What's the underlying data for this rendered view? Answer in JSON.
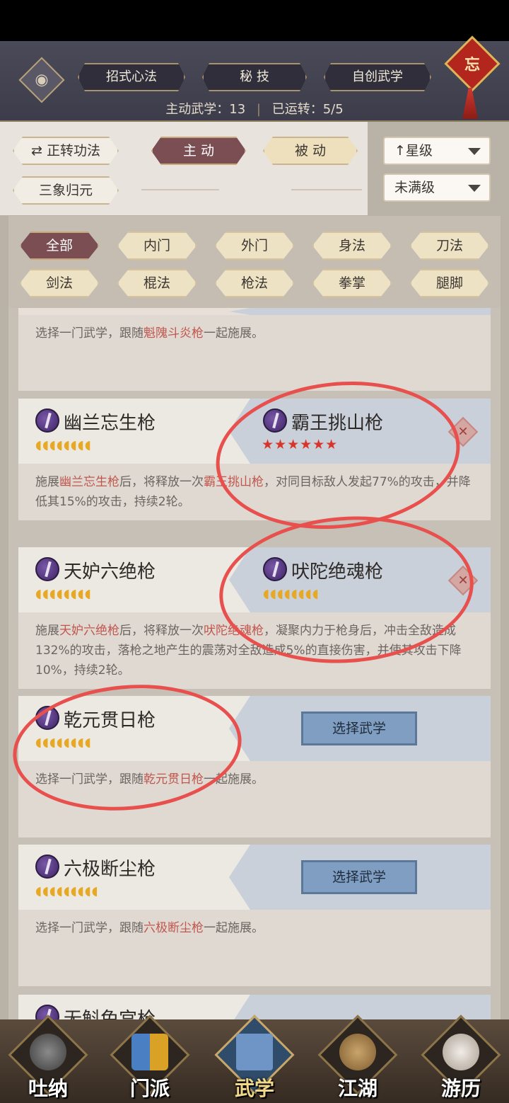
{
  "header": {
    "tabs": [
      {
        "label": "招式心法"
      },
      {
        "label": "秘 技"
      },
      {
        "label": "自创武学"
      }
    ],
    "badge": "忘",
    "stats": {
      "active_label": "主动武学：13",
      "running_label": "已运转：5/5"
    }
  },
  "filters": {
    "mode_btn": "正转功法",
    "active_btn": "主 动",
    "passive_btn": "被 动",
    "sanxiang_btn": "三象归元",
    "sort_dropdown": "星级",
    "level_dropdown": "未满级"
  },
  "categories": [
    "全部",
    "内门",
    "外门",
    "身法",
    "刀法",
    "剑法",
    "棍法",
    "枪法",
    "拳掌",
    "腿脚"
  ],
  "cards": {
    "card0": {
      "desc_pre": "选择一门武学，跟随",
      "desc_hl": "魁隗斗炎枪",
      "desc_post": "一起施展。"
    },
    "card1": {
      "left_name": "幽兰忘生枪",
      "left_moons": "◖◖◖◖◖◖◖◖",
      "right_name": "霸王挑山枪",
      "right_stars": "★★★★★★",
      "desc_a": "施展",
      "desc_hl1": "幽兰忘生枪",
      "desc_b": "后，将释放一次",
      "desc_hl2": "霸王挑山枪",
      "desc_c": "，对同目标敌人发起77%的攻击，并降低其15%的攻击，持续2轮。"
    },
    "card2": {
      "left_name": "天妒六绝枪",
      "left_moons": "◖◖◖◖◖◖◖◖",
      "right_name": "吠陀绝魂枪",
      "right_moons": "◖◖◖◖◖◖◖◖",
      "desc_a": "施展",
      "desc_hl1": "天妒六绝枪",
      "desc_b": "后，将释放一次",
      "desc_hl2": "吠陀绝魂枪",
      "desc_c": "，凝聚内力于枪身后，冲击全敌造成132%的攻击，落枪之地产生的震荡对全敌造成5%的直接伤害，并使其攻击下降10%，持续2轮。"
    },
    "card3": {
      "left_name": "乾元贯日枪",
      "left_moons": "◖◖◖◖◖◖◖◖",
      "select_label": "选择武学",
      "desc_pre": "选择一门武学，跟随",
      "desc_hl": "乾元贯日枪",
      "desc_post": "一起施展。"
    },
    "card4": {
      "left_name": "六极断尘枪",
      "left_moons": "◖◖◖◖◖◖◖◖◖",
      "select_label": "选择武学",
      "desc_pre": "选择一门武学，跟随",
      "desc_hl": "六极断尘枪",
      "desc_post": "一起施展。"
    },
    "card5": {
      "left_name": "无斛免宫枪"
    }
  },
  "bottom_nav": [
    {
      "label": "吐纳",
      "icon": "meditation-figure-icon"
    },
    {
      "label": "门派",
      "icon": "sect-banner-icon"
    },
    {
      "label": "武学",
      "icon": "martial-book-icon"
    },
    {
      "label": "江湖",
      "icon": "straw-hat-icon"
    },
    {
      "label": "游历",
      "icon": "horse-icon"
    }
  ],
  "colors": {
    "header_bg": "#4b4a58",
    "active_tab": "#7a4e52",
    "highlight_text": "#c0574e",
    "select_button": "#7f9ec2",
    "annotation": "#e8504e"
  }
}
